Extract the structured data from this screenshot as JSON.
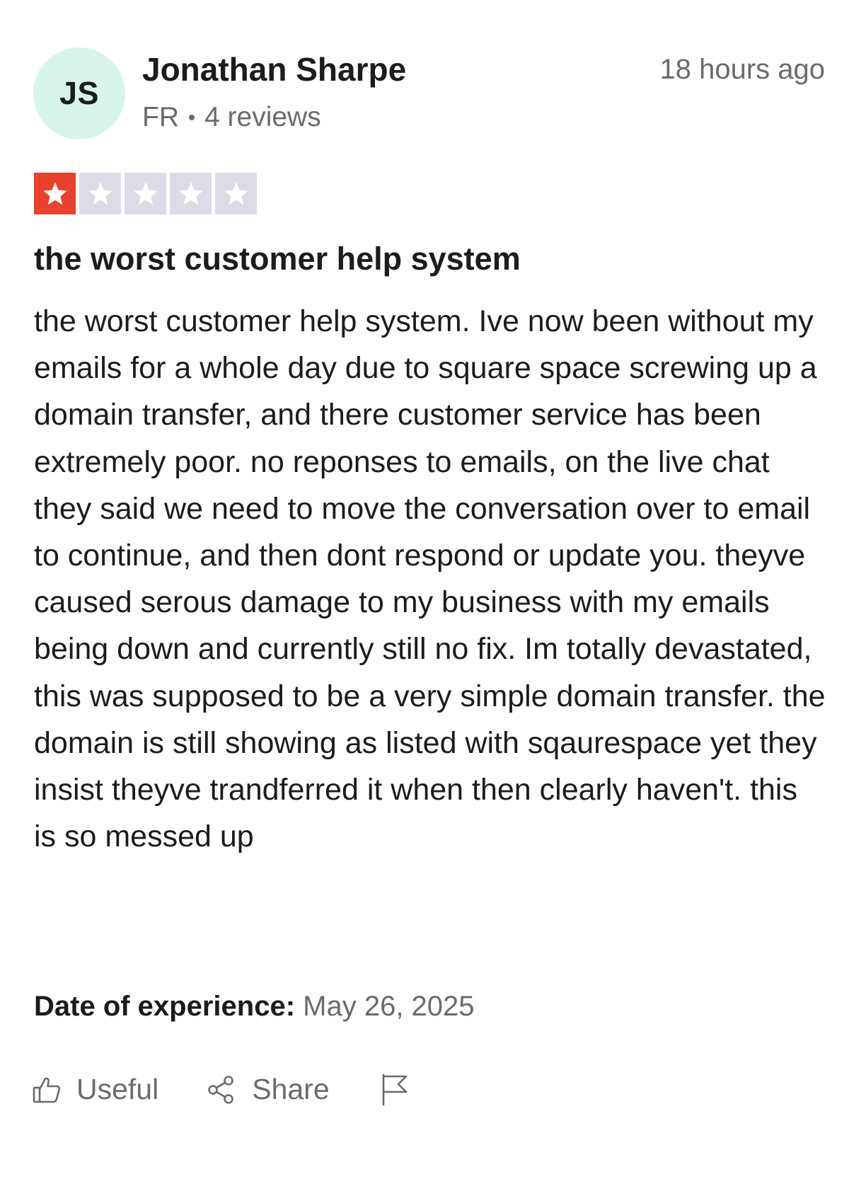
{
  "reviewer": {
    "initials": "JS",
    "name": "Jonathan Sharpe",
    "country": "FR",
    "review_count": "4 reviews",
    "avatar_color": "#d8f5ea"
  },
  "review": {
    "posted": "18 hours ago",
    "rating": 1,
    "rating_max": 5,
    "star_filled_color": "#e8412c",
    "star_empty_color": "#dcdce6",
    "title": "the worst customer help system",
    "body": "the worst customer help system. Ive now been without my emails for a whole day due to square space screwing up a domain transfer, and there customer service has been extremely poor. no reponses to emails, on the live chat they said we need to move the conversation over to email to continue, and then dont respond or update you. theyve caused serous damage to my business with my emails being down and currently still no fix. Im totally devastated, this was supposed to be a very simple domain transfer. the domain is still showing as listed with sqaurespace yet they insist theyve trandferred it when then clearly haven't. this is so messed up",
    "date_label": "Date of experience:",
    "date_value": "May 26, 2025"
  },
  "actions": {
    "useful_label": "Useful",
    "useful_icon": "thumbs-up-icon",
    "share_label": "Share",
    "share_icon": "share-icon",
    "report_icon": "flag-icon"
  }
}
